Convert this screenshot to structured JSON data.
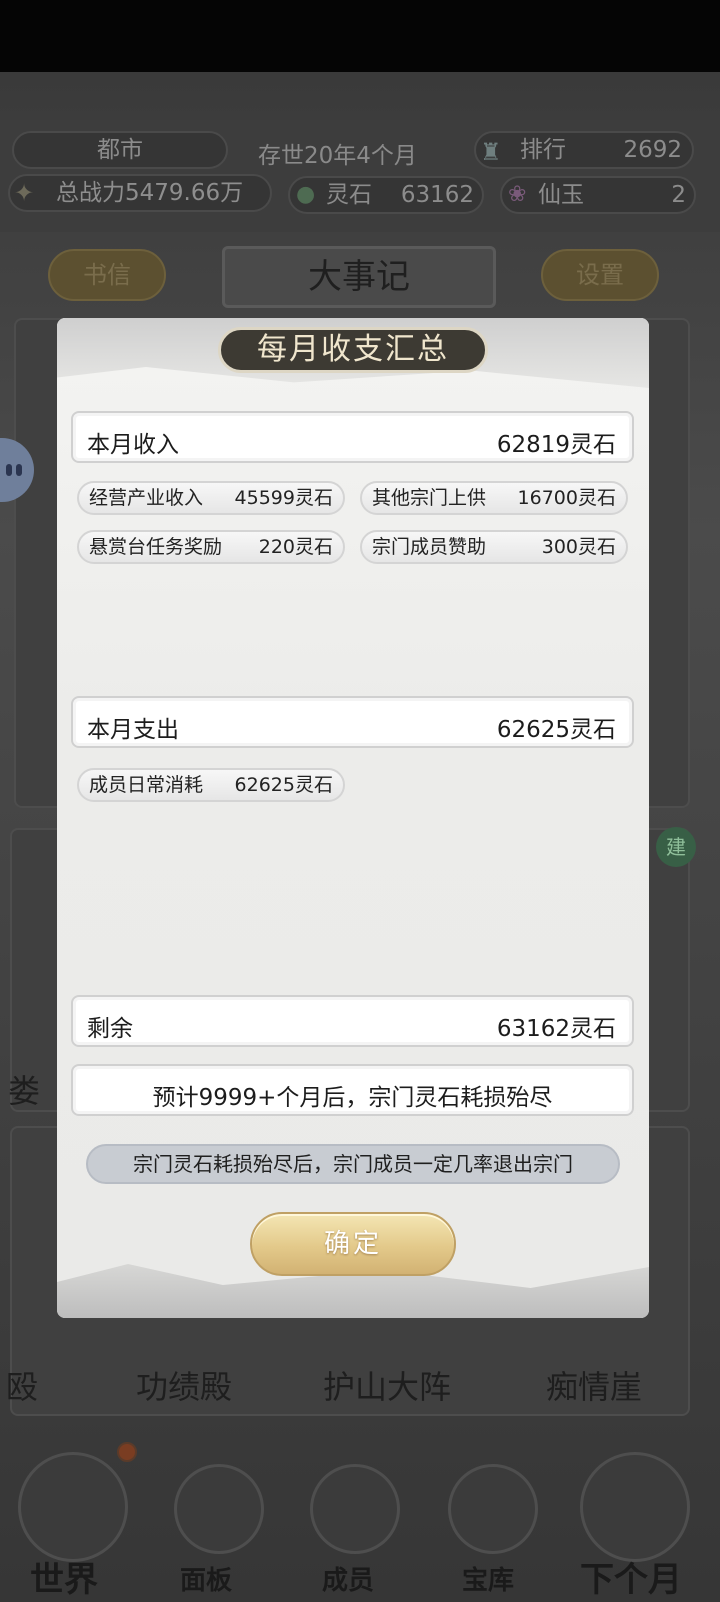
{
  "header": {
    "location": "都市",
    "age": "存世20年4个月",
    "rank_label": "排行",
    "rank_value": "2692",
    "power": "总战力5479.66万",
    "spirit_stone_label": "灵石",
    "spirit_stone_value": "63162",
    "jade_label": "仙玉",
    "jade_value": "2"
  },
  "top_buttons": {
    "letters": "书信",
    "title": "大事记",
    "settings": "设置"
  },
  "background": {
    "build_badge": "建",
    "buildings": [
      "娄",
      "殴",
      "功绩殿",
      "护山大阵",
      "痴情崖"
    ]
  },
  "bottom_nav": [
    "世界",
    "面板",
    "成员",
    "宝库",
    "下个月"
  ],
  "modal": {
    "title": "每月收支汇总",
    "income": {
      "label": "本月收入",
      "value": "62819灵石"
    },
    "income_items": [
      {
        "label": "经营产业收入",
        "value": "45599灵石"
      },
      {
        "label": "其他宗门上供",
        "value": "16700灵石"
      },
      {
        "label": "悬赏台任务奖励",
        "value": "220灵石"
      },
      {
        "label": "宗门成员赞助",
        "value": "300灵石"
      }
    ],
    "expense": {
      "label": "本月支出",
      "value": "62625灵石"
    },
    "expense_items": [
      {
        "label": "成员日常消耗",
        "value": "62625灵石"
      }
    ],
    "remaining": {
      "label": "剩余",
      "value": "63162灵石"
    },
    "forecast": "预计9999+个月后，宗门灵石耗损殆尽",
    "warning": "宗门灵石耗损殆尽后，宗门成员一定几率退出宗门",
    "confirm": "确定"
  }
}
